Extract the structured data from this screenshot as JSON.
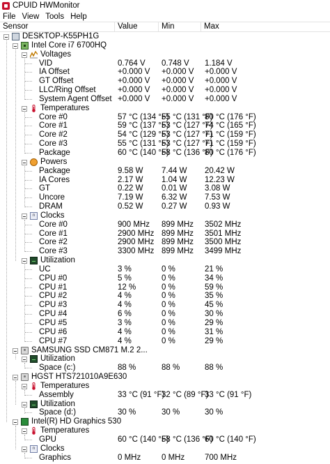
{
  "window": {
    "title": "CPUID HWMonitor"
  },
  "menu": [
    "File",
    "View",
    "Tools",
    "Help"
  ],
  "columns": [
    "Sensor",
    "Value",
    "Min",
    "Max"
  ],
  "tree": [
    {
      "level": 0,
      "type": "node",
      "icon": "pc-icon",
      "label": "DESKTOP-K55PH1G"
    },
    {
      "level": 1,
      "type": "node",
      "icon": "cpu-icon",
      "label": "Intel Core i7 6700HQ"
    },
    {
      "level": 2,
      "type": "node",
      "icon": "voltage-icon",
      "label": "Voltages"
    },
    {
      "level": 3,
      "type": "leaf",
      "label": "VID",
      "value": "0.764 V",
      "min": "0.748 V",
      "max": "1.184 V"
    },
    {
      "level": 3,
      "type": "leaf",
      "label": "IA Offset",
      "value": "+0.000 V",
      "min": "+0.000 V",
      "max": "+0.000 V"
    },
    {
      "level": 3,
      "type": "leaf",
      "label": "GT Offset",
      "value": "+0.000 V",
      "min": "+0.000 V",
      "max": "+0.000 V"
    },
    {
      "level": 3,
      "type": "leaf",
      "label": "LLC/Ring Offset",
      "value": "+0.000 V",
      "min": "+0.000 V",
      "max": "+0.000 V"
    },
    {
      "level": 3,
      "type": "leaf",
      "label": "System Agent Offset",
      "value": "+0.000 V",
      "min": "+0.000 V",
      "max": "+0.000 V"
    },
    {
      "level": 2,
      "type": "node",
      "icon": "temperature-icon",
      "label": "Temperatures"
    },
    {
      "level": 3,
      "type": "leaf",
      "label": "Core #0",
      "value": "57 °C  (134 °F)",
      "min": "55 °C  (131 °F)",
      "max": "80 °C  (176 °F)"
    },
    {
      "level": 3,
      "type": "leaf",
      "label": "Core #1",
      "value": "59 °C  (137 °F)",
      "min": "53 °C  (127 °F)",
      "max": "74 °C  (165 °F)"
    },
    {
      "level": 3,
      "type": "leaf",
      "label": "Core #2",
      "value": "54 °C  (129 °F)",
      "min": "53 °C  (127 °F)",
      "max": "71 °C  (159 °F)"
    },
    {
      "level": 3,
      "type": "leaf",
      "label": "Core #3",
      "value": "55 °C  (131 °F)",
      "min": "53 °C  (127 °F)",
      "max": "71 °C  (159 °F)"
    },
    {
      "level": 3,
      "type": "leaf",
      "label": "Package",
      "value": "60 °C  (140 °F)",
      "min": "58 °C  (136 °F)",
      "max": "80 °C  (176 °F)"
    },
    {
      "level": 2,
      "type": "node",
      "icon": "power-icon",
      "label": "Powers"
    },
    {
      "level": 3,
      "type": "leaf",
      "label": "Package",
      "value": "9.58 W",
      "min": "7.44 W",
      "max": "20.42 W"
    },
    {
      "level": 3,
      "type": "leaf",
      "label": "IA Cores",
      "value": "2.17 W",
      "min": "1.04 W",
      "max": "12.23 W"
    },
    {
      "level": 3,
      "type": "leaf",
      "label": "GT",
      "value": "0.22 W",
      "min": "0.01 W",
      "max": "3.08 W"
    },
    {
      "level": 3,
      "type": "leaf",
      "label": "Uncore",
      "value": "7.19 W",
      "min": "6.32 W",
      "max": "7.53 W"
    },
    {
      "level": 3,
      "type": "leaf",
      "label": "DRAM",
      "value": "0.52 W",
      "min": "0.27 W",
      "max": "0.93 W"
    },
    {
      "level": 2,
      "type": "node",
      "icon": "clock-icon",
      "label": "Clocks"
    },
    {
      "level": 3,
      "type": "leaf",
      "label": "Core #0",
      "value": "900 MHz",
      "min": "899 MHz",
      "max": "3502 MHz"
    },
    {
      "level": 3,
      "type": "leaf",
      "label": "Core #1",
      "value": "2900 MHz",
      "min": "899 MHz",
      "max": "3501 MHz"
    },
    {
      "level": 3,
      "type": "leaf",
      "label": "Core #2",
      "value": "2900 MHz",
      "min": "899 MHz",
      "max": "3500 MHz"
    },
    {
      "level": 3,
      "type": "leaf",
      "label": "Core #3",
      "value": "3300 MHz",
      "min": "899 MHz",
      "max": "3499 MHz"
    },
    {
      "level": 2,
      "type": "node",
      "icon": "utilization-icon",
      "label": "Utilization"
    },
    {
      "level": 3,
      "type": "leaf",
      "label": "UC",
      "value": "3 %",
      "min": "0 %",
      "max": "21 %"
    },
    {
      "level": 3,
      "type": "leaf",
      "label": "CPU #0",
      "value": "5 %",
      "min": "0 %",
      "max": "34 %"
    },
    {
      "level": 3,
      "type": "leaf",
      "label": "CPU #1",
      "value": "12 %",
      "min": "0 %",
      "max": "59 %"
    },
    {
      "level": 3,
      "type": "leaf",
      "label": "CPU #2",
      "value": "4 %",
      "min": "0 %",
      "max": "35 %"
    },
    {
      "level": 3,
      "type": "leaf",
      "label": "CPU #3",
      "value": "4 %",
      "min": "0 %",
      "max": "45 %"
    },
    {
      "level": 3,
      "type": "leaf",
      "label": "CPU #4",
      "value": "6 %",
      "min": "0 %",
      "max": "30 %"
    },
    {
      "level": 3,
      "type": "leaf",
      "label": "CPU #5",
      "value": "3 %",
      "min": "0 %",
      "max": "29 %"
    },
    {
      "level": 3,
      "type": "leaf",
      "label": "CPU #6",
      "value": "4 %",
      "min": "0 %",
      "max": "31 %"
    },
    {
      "level": 3,
      "type": "leaf",
      "label": "CPU #7",
      "value": "4 %",
      "min": "0 %",
      "max": "29 %"
    },
    {
      "level": 1,
      "type": "node",
      "icon": "disk-icon",
      "label": "SAMSUNG SSD CM871 M.2 2..."
    },
    {
      "level": 2,
      "type": "node",
      "icon": "utilization-icon",
      "label": "Utilization"
    },
    {
      "level": 3,
      "type": "leaf",
      "label": "Space (c:)",
      "value": "88 %",
      "min": "88 %",
      "max": "88 %"
    },
    {
      "level": 1,
      "type": "node",
      "icon": "disk-icon",
      "label": "HGST HTS721010A9E630"
    },
    {
      "level": 2,
      "type": "node",
      "icon": "temperature-icon",
      "label": "Temperatures"
    },
    {
      "level": 3,
      "type": "leaf",
      "label": "Assembly",
      "value": "33 °C  (91 °F)",
      "min": "32 °C  (89 °F)",
      "max": "33 °C  (91 °F)"
    },
    {
      "level": 2,
      "type": "node",
      "icon": "utilization-icon",
      "label": "Utilization"
    },
    {
      "level": 3,
      "type": "leaf",
      "label": "Space (d:)",
      "value": "30 %",
      "min": "30 %",
      "max": "30 %"
    },
    {
      "level": 1,
      "type": "node",
      "icon": "gpu-icon",
      "label": "Intel(R) HD Graphics 530"
    },
    {
      "level": 2,
      "type": "node",
      "icon": "temperature-icon",
      "label": "Temperatures"
    },
    {
      "level": 3,
      "type": "leaf",
      "label": "GPU",
      "value": "60 °C  (140 °F)",
      "min": "58 °C  (136 °F)",
      "max": "60 °C  (140 °F)"
    },
    {
      "level": 2,
      "type": "node",
      "icon": "clock-icon",
      "label": "Clocks"
    },
    {
      "level": 3,
      "type": "leaf",
      "label": "Graphics",
      "value": "0 MHz",
      "min": "0 MHz",
      "max": "700 MHz"
    }
  ]
}
